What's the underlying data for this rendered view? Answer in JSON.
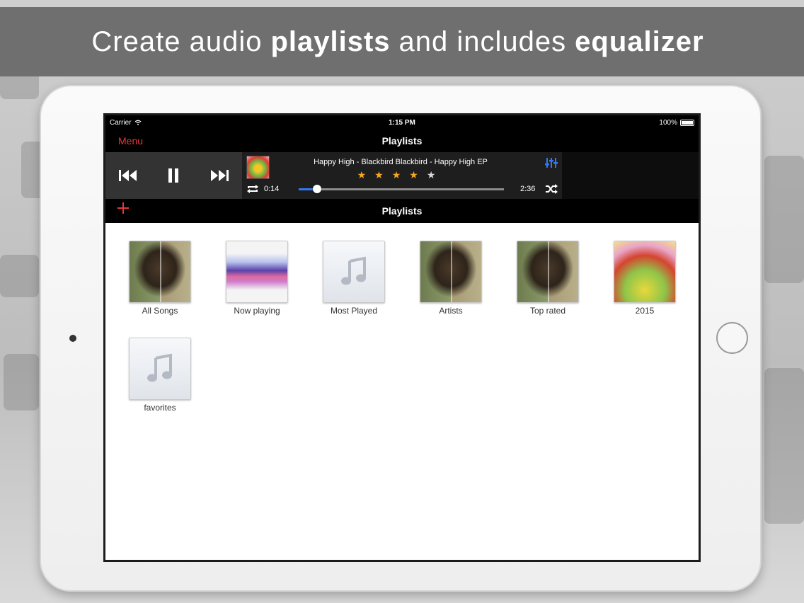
{
  "banner": {
    "part1": "Create audio",
    "bold1": "playlists",
    "part2": "and includes",
    "bold2": "equalizer"
  },
  "status_bar": {
    "carrier": "Carrier",
    "time": "1:15 PM",
    "battery": "100%"
  },
  "nav_bar": {
    "menu_label": "Menu",
    "title": "Playlists"
  },
  "player": {
    "track_title": "Happy High - Blackbird Blackbird - Happy High EP",
    "rating": 4,
    "rating_max": 5,
    "current_time": "0:14",
    "total_time": "2:36",
    "progress_fraction": 0.09,
    "accent_color": "#3478f6"
  },
  "sub_bar": {
    "add_icon": "plus-icon",
    "title": "Playlists"
  },
  "playlists": [
    {
      "label": "All Songs",
      "art": "face"
    },
    {
      "label": "Now playing",
      "art": "wave"
    },
    {
      "label": "Most Played",
      "art": "note"
    },
    {
      "label": "Artists",
      "art": "face"
    },
    {
      "label": "Top rated",
      "art": "face"
    },
    {
      "label": "2015",
      "art": "bird"
    },
    {
      "label": "favorites",
      "art": "note"
    }
  ],
  "colors": {
    "menu_red": "#e53935",
    "star_color": "#f5a623"
  }
}
